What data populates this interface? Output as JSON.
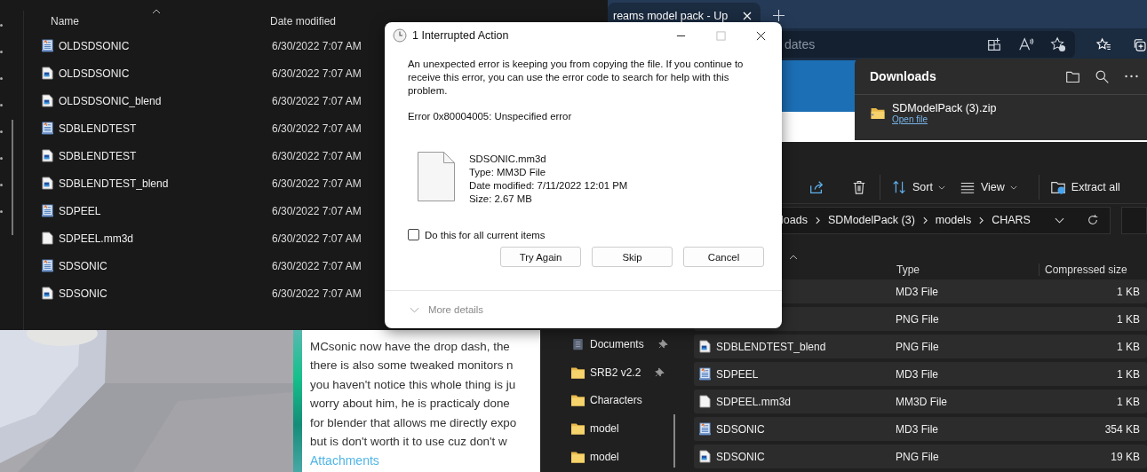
{
  "explorer_left": {
    "columns": [
      "Name",
      "Date modified"
    ],
    "rows": [
      {
        "name": "OLDSDSONIC",
        "kind": "md3",
        "date": "6/30/2022 7:07 AM"
      },
      {
        "name": "OLDSDSONIC",
        "kind": "png",
        "date": "6/30/2022 7:07 AM"
      },
      {
        "name": "OLDSDSONIC_blend",
        "kind": "png",
        "date": "6/30/2022 7:07 AM"
      },
      {
        "name": "SDBLENDTEST",
        "kind": "md3",
        "date": "6/30/2022 7:07 AM"
      },
      {
        "name": "SDBLENDTEST",
        "kind": "png",
        "date": "6/30/2022 7:07 AM"
      },
      {
        "name": "SDBLENDTEST_blend",
        "kind": "png",
        "date": "6/30/2022 7:07 AM"
      },
      {
        "name": "SDPEEL",
        "kind": "md3",
        "date": "6/30/2022 7:07 AM"
      },
      {
        "name": "SDPEEL.mm3d",
        "kind": "mm3d",
        "date": "6/30/2022 7:07 AM"
      },
      {
        "name": "SDSONIC",
        "kind": "md3",
        "date": "6/30/2022 7:07 AM"
      },
      {
        "name": "SDSONIC",
        "kind": "png",
        "date": "6/30/2022 7:07 AM"
      }
    ]
  },
  "browser": {
    "tab": {
      "title": "reams model pack - Up"
    },
    "address": {
      "value": "dates"
    }
  },
  "downloads": {
    "title": "Downloads",
    "file": "SDModelPack (3).zip",
    "link": "Open file"
  },
  "web_page": {
    "lines": [
      "MCsonic now have the drop dash, the",
      "there is also some tweaked monitors n",
      "you haven't notice this whole thing is ju",
      "worry about him, he is practicaly done",
      "for blender that allows me directly expo",
      "but is don't worth it to use cuz don't w"
    ],
    "attachments": "Attachments"
  },
  "explorer_right": {
    "toolbar": [
      "Sort",
      "View",
      "Extract all"
    ],
    "breadcrumb": [
      "loads",
      "SDModelPack (3)",
      "models",
      "CHARS"
    ],
    "nav": [
      {
        "label": "Documents",
        "kind": "documents",
        "pinned": true
      },
      {
        "label": "SRB2 v2.2",
        "kind": "folder",
        "pinned": true
      },
      {
        "label": "Characters",
        "kind": "folder",
        "pinned": false
      },
      {
        "label": "model",
        "kind": "folder",
        "pinned": false
      },
      {
        "label": "model",
        "kind": "folder",
        "pinned": false
      }
    ],
    "columns": [
      "Type",
      "Compressed size"
    ],
    "rows": [
      {
        "type": "MD3 File",
        "size": "1 KB"
      },
      {
        "type": "PNG File",
        "size": "1 KB"
      },
      {
        "name": "SDBLENDTEST_blend",
        "kind": "png",
        "type": "PNG File",
        "size": "1 KB"
      },
      {
        "name": "SDPEEL",
        "kind": "md3",
        "type": "MD3 File",
        "size": "1 KB"
      },
      {
        "name": "SDPEEL.mm3d",
        "kind": "mm3d",
        "type": "MM3D File",
        "size": "1 KB"
      },
      {
        "name": "SDSONIC",
        "kind": "md3",
        "type": "MD3 File",
        "size": "354 KB"
      },
      {
        "name": "SDSONIC",
        "kind": "png",
        "type": "PNG File",
        "size": "19 KB"
      }
    ]
  },
  "dialog": {
    "title": "1 Interrupted Action",
    "message": "An unexpected error is keeping you from copying the file. If you continue to receive this error, you can use the error code to search for help with this problem.",
    "error": "Error 0x80004005: Unspecified error",
    "file": {
      "name": "SDSONIC.mm3d",
      "type": "Type: MM3D File",
      "modified": "Date modified: 7/11/2022 12:01 PM",
      "size": "Size: 2.67 MB"
    },
    "checkbox": {
      "label": "Do this for all current items",
      "checked": false
    },
    "buttons": [
      "Try Again",
      "Skip",
      "Cancel"
    ],
    "more_details": "More details"
  }
}
